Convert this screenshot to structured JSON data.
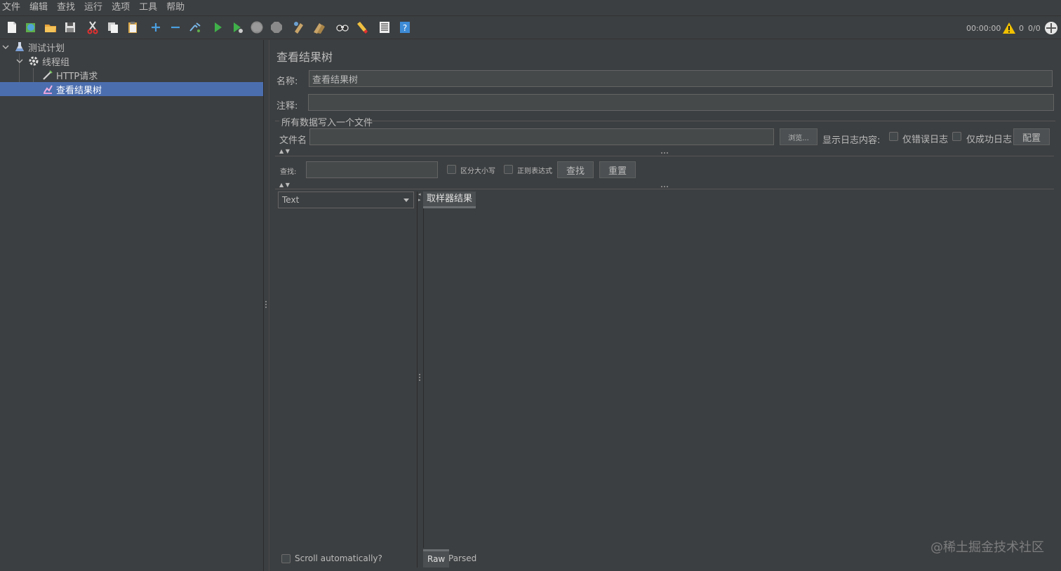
{
  "menu": [
    "文件",
    "编辑",
    "查找",
    "运行",
    "选项",
    "工具",
    "帮助"
  ],
  "toolbar": {
    "timer": "00:00:00",
    "warn_count": "0",
    "threads": "0/0",
    "icons": [
      "new-icon",
      "templates-icon",
      "open-icon",
      "save-icon",
      "cut-icon",
      "copy-icon",
      "paste-icon",
      "expand-icon",
      "collapse-icon",
      "toggle-icon",
      "start-icon",
      "start-no-pause-icon",
      "stop-icon",
      "shutdown-icon",
      "clear-icon",
      "clear-all-icon",
      "search-icon",
      "reset-search-icon",
      "function-helper-icon",
      "help-icon"
    ]
  },
  "tree": {
    "items": [
      {
        "label": "测试计划",
        "icon": "test-plan-icon"
      },
      {
        "label": "线程组",
        "icon": "thread-group-icon"
      },
      {
        "label": "HTTP请求",
        "icon": "sampler-icon"
      },
      {
        "label": "查看结果树",
        "icon": "listener-icon"
      }
    ]
  },
  "panel": {
    "title": "查看结果树",
    "name_label": "名称:",
    "name_value": "查看结果树",
    "comment_label": "注释:",
    "comment_value": "",
    "file_section": "所有数据写入一个文件",
    "file_label": "文件名",
    "file_value": "",
    "browse_button": "浏览...",
    "log_label": "显示日志内容:",
    "errors_only": "仅错误日志",
    "success_only": "仅成功日志",
    "configure_button": "配置",
    "search_label": "查找:",
    "search_value": "",
    "case_sensitive": "区分大小写",
    "regex": "正则表达式",
    "find_button": "查找",
    "reset_button": "重置",
    "renderer_selected": "Text",
    "result_tab": "取样器结果",
    "scroll_auto": "Scroll automatically?",
    "tab_raw": "Raw",
    "tab_parsed": "Parsed"
  },
  "watermark": "@稀土掘金技术社区",
  "colors": {
    "background": "#3c3f41",
    "selection": "#4b6eaf",
    "field": "#45494a",
    "text": "#bbbbbb"
  }
}
